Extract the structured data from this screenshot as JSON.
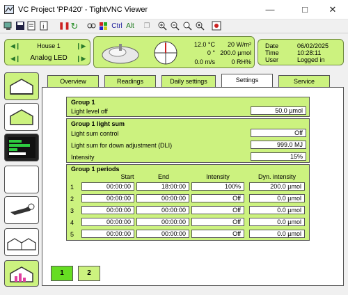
{
  "window": {
    "title": "VC Project 'PP420' - TightVNC Viewer"
  },
  "toolbar": {
    "ctrl": "Ctrl",
    "alt": "Alt"
  },
  "house": {
    "name": "House 1",
    "mode": "Analog LED"
  },
  "weather": {
    "temp": "12.0 °C",
    "radiation": "20 W/m²",
    "direction": "0 °",
    "co2": "200.0 µmol",
    "wind": "0.0 m/s",
    "humidity": "0 RH%"
  },
  "status": {
    "date_label": "Date",
    "date": "06/02/2025",
    "time_label": "Time",
    "time": "10:28:11",
    "user_label": "User",
    "user": "Logged in"
  },
  "tabs": [
    "Overview",
    "Readings",
    "Daily settings",
    "Settings",
    "Service"
  ],
  "group1": {
    "title": "Group 1",
    "light_level_off_label": "Light level off",
    "light_level_off": "50.0 µmol"
  },
  "lightsum": {
    "title": "Group 1 light sum",
    "control_label": "Light sum control",
    "control": "Off",
    "dli_label": "Light sum for down adjustment (DLI)",
    "dli": "999.0 MJ",
    "intensity_label": "Intensity",
    "intensity": "15%"
  },
  "periods": {
    "title": "Group 1 periods",
    "headers": {
      "start": "Start",
      "end": "End",
      "intensity": "Intensity",
      "dyn": "Dyn. intensity"
    },
    "rows": [
      {
        "n": "1",
        "start": "00:00:00",
        "end": "18:00:00",
        "intensity": "100%",
        "dyn": "200.0 µmol"
      },
      {
        "n": "2",
        "start": "00:00:00",
        "end": "00:00:00",
        "intensity": "Off",
        "dyn": "0.0 µmol"
      },
      {
        "n": "3",
        "start": "00:00:00",
        "end": "00:00:00",
        "intensity": "Off",
        "dyn": "0.0 µmol"
      },
      {
        "n": "4",
        "start": "00:00:00",
        "end": "00:00:00",
        "intensity": "Off",
        "dyn": "0.0 µmol"
      },
      {
        "n": "5",
        "start": "00:00:00",
        "end": "00:00:00",
        "intensity": "Off",
        "dyn": "0.0 µmol"
      }
    ]
  },
  "pages": [
    "1",
    "2"
  ],
  "colors": {
    "lime": "#ccf27f",
    "active_page": "#66dd22",
    "accent_red": "#cc2222"
  }
}
